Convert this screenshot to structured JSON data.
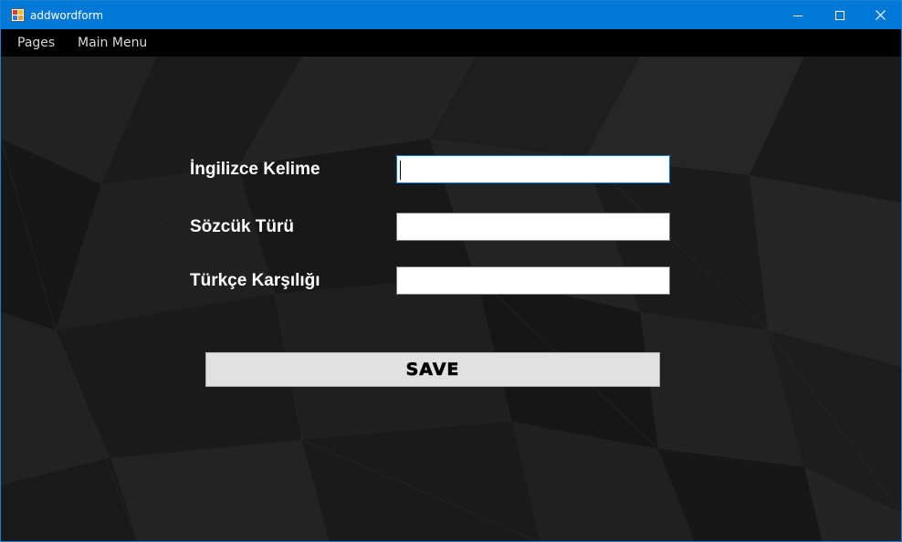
{
  "window": {
    "title": "addwordform",
    "icon": "winforms-app-icon",
    "controls": {
      "minimize": "minimize-icon",
      "maximize": "maximize-icon",
      "close": "close-icon"
    },
    "accent_color": "#0078d7"
  },
  "menu": {
    "items": [
      {
        "label": "Pages"
      },
      {
        "label": "Main Menu"
      }
    ]
  },
  "form": {
    "fields": [
      {
        "label": "İngilizce Kelime",
        "value": "",
        "focused": true
      },
      {
        "label": "Sözcük Türü",
        "value": "",
        "focused": false
      },
      {
        "label": "Türkçe Karşılığı",
        "value": "",
        "focused": false
      }
    ],
    "save_label": "SAVE"
  },
  "colors": {
    "background": "#1a1a1a",
    "label_text": "#ffffff",
    "button_face": "#e1e1e1"
  }
}
